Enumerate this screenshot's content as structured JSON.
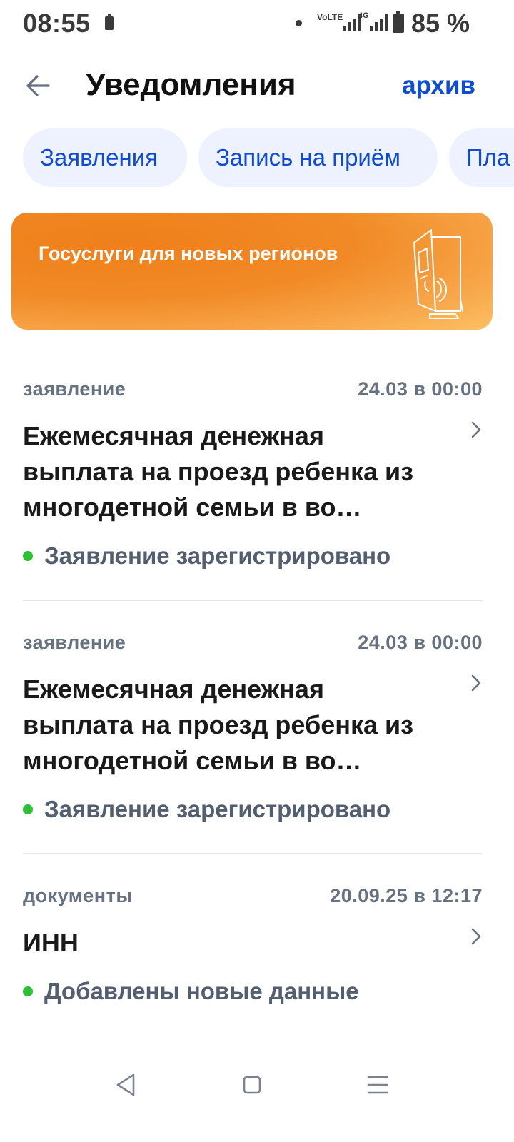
{
  "status_bar": {
    "time": "08:55",
    "network_lte": "VoLTE",
    "network_4g": "4G",
    "battery_percent": "85 %"
  },
  "header": {
    "title": "Уведомления",
    "archive_label": "архив"
  },
  "chips": [
    {
      "label": "Заявления"
    },
    {
      "label": "Запись на приём"
    },
    {
      "label": "Пла"
    }
  ],
  "banner": {
    "title": "Госуслуги для новых регионов"
  },
  "notifications": [
    {
      "category": "заявление",
      "date": "24.03 в 00:00",
      "title": "Ежемесячная денежная выплата на проезд ребенка из многодетной семьи в во…",
      "status": "Заявление зарегистрировано"
    },
    {
      "category": "заявление",
      "date": "24.03 в 00:00",
      "title": "Ежемесячная денежная выплата на проезд ребенка из многодетной семьи в во…",
      "status": "Заявление зарегистрировано"
    },
    {
      "category": "документы",
      "date": "20.09.25 в 12:17",
      "title": "ИНН",
      "status": "Добавлены новые данные"
    }
  ],
  "colors": {
    "accent": "#0d4cd3",
    "chip_bg": "#edf2fe",
    "banner": "#ef7f1a",
    "status_ok": "#2fbf35"
  },
  "icons": {
    "back": "arrow-left-icon",
    "chevron": "chevron-right-icon",
    "nav_back": "triangle-back-icon",
    "nav_home": "square-home-icon",
    "nav_menu": "menu-lines-icon"
  }
}
